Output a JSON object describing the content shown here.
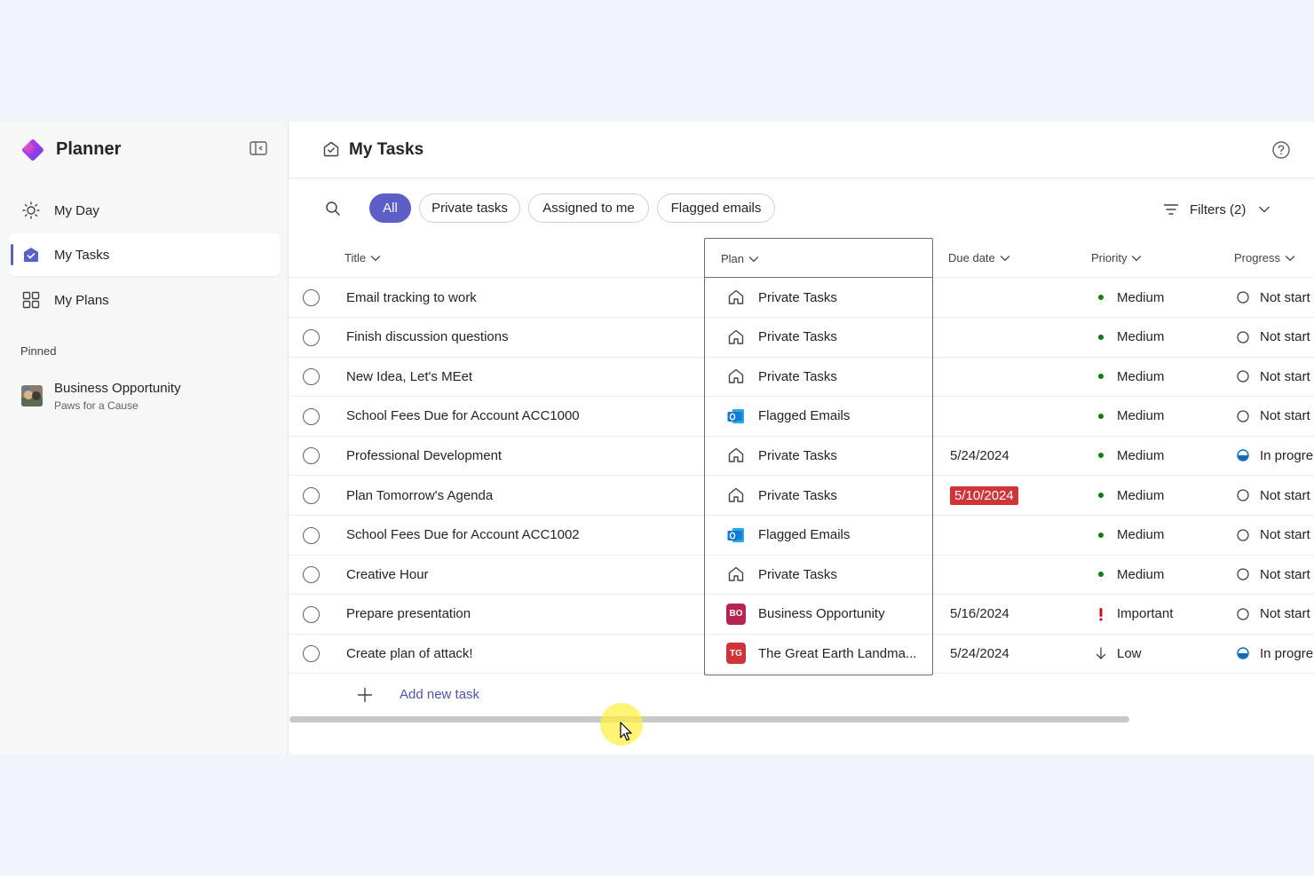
{
  "app": {
    "name": "Planner",
    "colors": {
      "accent": "#5b5fc7",
      "overdue": "#d13438",
      "important": "#c50f1f",
      "link": "#4f52b2"
    }
  },
  "sidebar": {
    "items": [
      {
        "label": "My Day",
        "icon": "sun-icon",
        "active": false
      },
      {
        "label": "My Tasks",
        "icon": "tasks-icon",
        "active": true
      },
      {
        "label": "My Plans",
        "icon": "grid-icon",
        "active": false
      }
    ],
    "pinned_label": "Pinned",
    "pinned": [
      {
        "title": "Business Opportunity",
        "subtitle": "Paws for a Cause"
      }
    ]
  },
  "header": {
    "title": "My Tasks"
  },
  "toolbar": {
    "chips": [
      {
        "label": "All",
        "active": true
      },
      {
        "label": "Private tasks",
        "active": false
      },
      {
        "label": "Assigned to me",
        "active": false
      },
      {
        "label": "Flagged emails",
        "active": false
      }
    ],
    "filters_label": "Filters (2)"
  },
  "table": {
    "columns": {
      "title": "Title",
      "plan": "Plan",
      "due": "Due date",
      "priority": "Priority",
      "progress": "Progress"
    },
    "rows": [
      {
        "title": "Email tracking to work",
        "plan": "Private Tasks",
        "plan_icon": "home-icon",
        "due": "",
        "overdue": false,
        "priority": "Medium",
        "priority_icon": "dot",
        "progress": "Not start",
        "progress_icon": "circle"
      },
      {
        "title": "Finish discussion questions",
        "plan": "Private Tasks",
        "plan_icon": "home-icon",
        "due": "",
        "overdue": false,
        "priority": "Medium",
        "priority_icon": "dot",
        "progress": "Not start",
        "progress_icon": "circle"
      },
      {
        "title": "New Idea, Let's MEet",
        "plan": "Private Tasks",
        "plan_icon": "home-icon",
        "due": "",
        "overdue": false,
        "priority": "Medium",
        "priority_icon": "dot",
        "progress": "Not start",
        "progress_icon": "circle"
      },
      {
        "title": "School Fees Due for Account ACC1000",
        "plan": "Flagged Emails",
        "plan_icon": "outlook-icon",
        "due": "",
        "overdue": false,
        "priority": "Medium",
        "priority_icon": "dot",
        "progress": "Not start",
        "progress_icon": "circle"
      },
      {
        "title": "Professional Development",
        "plan": "Private Tasks",
        "plan_icon": "home-icon",
        "due": "5/24/2024",
        "overdue": false,
        "priority": "Medium",
        "priority_icon": "dot",
        "progress": "In progre",
        "progress_icon": "half"
      },
      {
        "title": "Plan Tomorrow's Agenda",
        "plan": "Private Tasks",
        "plan_icon": "home-icon",
        "due": "5/10/2024",
        "overdue": true,
        "priority": "Medium",
        "priority_icon": "dot",
        "progress": "Not start",
        "progress_icon": "circle"
      },
      {
        "title": "School Fees Due for Account ACC1002",
        "plan": "Flagged Emails",
        "plan_icon": "outlook-icon",
        "due": "",
        "overdue": false,
        "priority": "Medium",
        "priority_icon": "dot",
        "progress": "Not start",
        "progress_icon": "circle"
      },
      {
        "title": "Creative Hour",
        "plan": "Private Tasks",
        "plan_icon": "home-icon",
        "due": "",
        "overdue": false,
        "priority": "Medium",
        "priority_icon": "dot",
        "progress": "Not start",
        "progress_icon": "circle"
      },
      {
        "title": "Prepare presentation",
        "plan": "Business Opportunity",
        "plan_icon": "badge",
        "plan_badge": "BO",
        "plan_badge_color": "#b4264f",
        "due": "5/16/2024",
        "overdue": false,
        "priority": "Important",
        "priority_icon": "exclaim",
        "progress": "Not start",
        "progress_icon": "circle"
      },
      {
        "title": "Create plan of attack!",
        "plan": "The Great Earth Landma...",
        "plan_icon": "badge",
        "plan_badge": "TG",
        "plan_badge_color": "#d13438",
        "due": "5/24/2024",
        "overdue": false,
        "priority": "Low",
        "priority_icon": "arrow-down",
        "progress": "In progre",
        "progress_icon": "half"
      }
    ],
    "add_label": "Add new task"
  }
}
